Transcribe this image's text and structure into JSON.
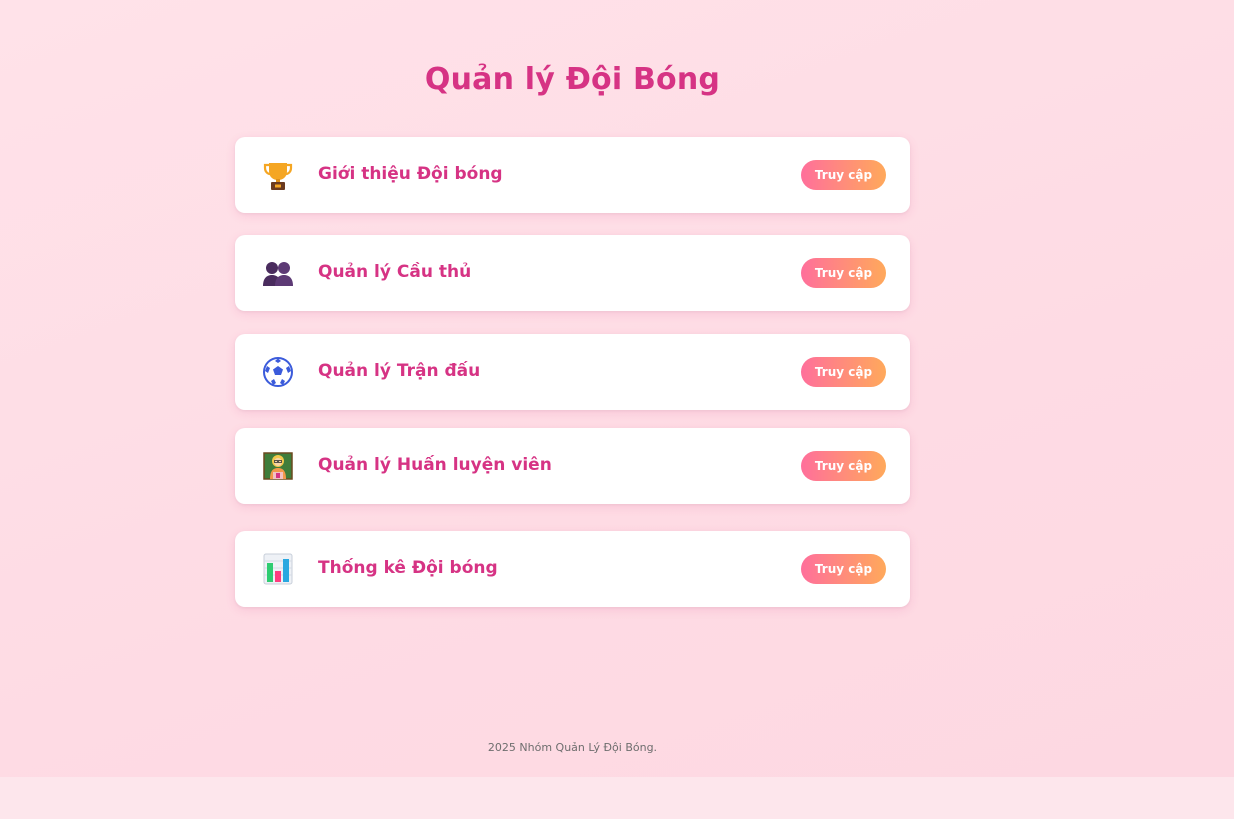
{
  "header": {
    "title": "Quản lý Đội Bóng"
  },
  "cards": [
    {
      "label": "Giới thiệu Đội bóng",
      "icon": "trophy-icon",
      "button_label": "Truy cập"
    },
    {
      "label": "Quản lý Cầu thủ",
      "icon": "players-icon",
      "button_label": "Truy cập"
    },
    {
      "label": "Quản lý Trận đấu",
      "icon": "soccer-ball-icon",
      "button_label": "Truy cập"
    },
    {
      "label": "Quản lý Huấn luyện viên",
      "icon": "coach-icon",
      "button_label": "Truy cập"
    },
    {
      "label": "Thống kê Đội bóng",
      "icon": "bar-chart-icon",
      "button_label": "Truy cập"
    }
  ],
  "footer": {
    "text": "2025 Nhóm Quản Lý Đội Bóng."
  },
  "colors": {
    "accent": "#d63384",
    "button_gradient_start": "#ff6f9b",
    "button_gradient_end": "#ffa95b",
    "background": "#fde6ec"
  }
}
